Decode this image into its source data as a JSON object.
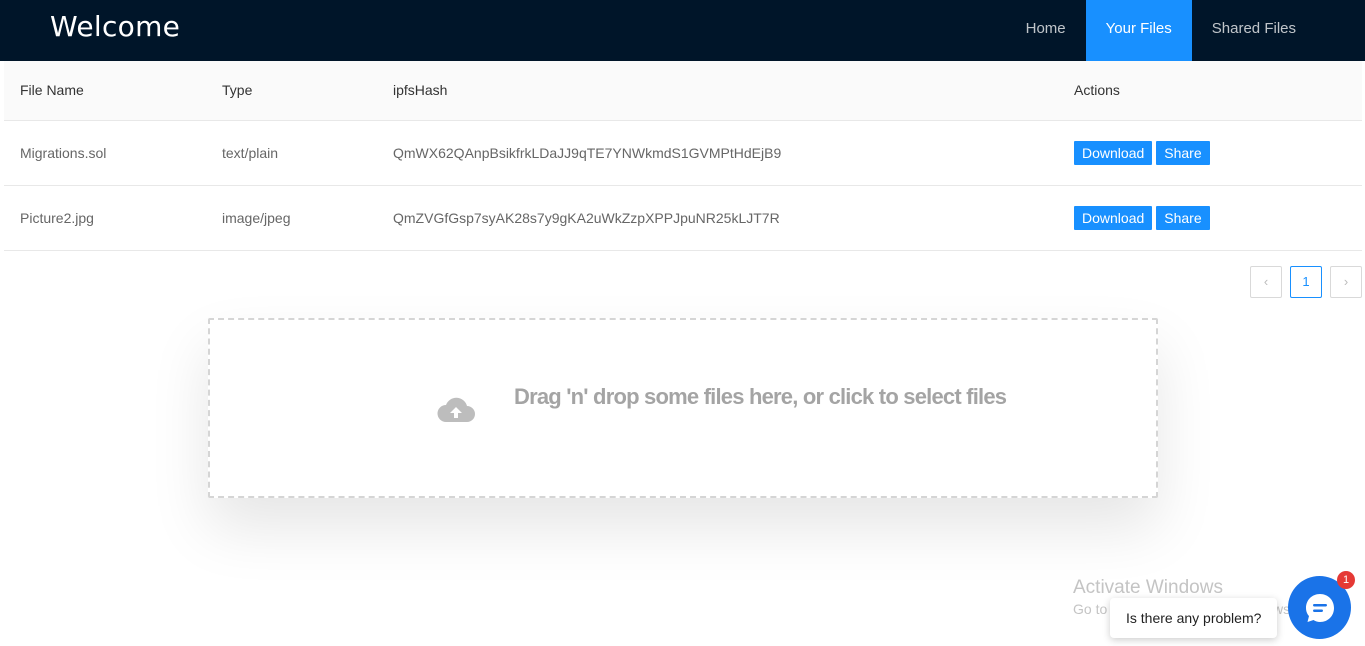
{
  "nav": {
    "brand": "Welcome",
    "items": [
      {
        "label": "Home",
        "active": false
      },
      {
        "label": "Your Files",
        "active": true
      },
      {
        "label": "Shared Files",
        "active": false
      }
    ]
  },
  "table": {
    "headers": [
      "File Name",
      "Type",
      "ipfsHash",
      "Actions"
    ],
    "rows": [
      {
        "name": "Migrations.sol",
        "type": "text/plain",
        "hash": "QmWX62QAnpBsikfrkLDaJJ9qTE7YNWkmdS1GVMPtHdEjB9"
      },
      {
        "name": "Picture2.jpg",
        "type": "image/jpeg",
        "hash": "QmZVGfGsp7syAK28s7y9gKA2uWkZzpXPPJpuNR25kLJT7R"
      }
    ],
    "download_label": "Download",
    "share_label": "Share"
  },
  "pagination": {
    "prev": "‹",
    "current": "1",
    "next": "›"
  },
  "dropzone": {
    "text": "Drag 'n' drop some files here, or click to select files",
    "icon": "cloud-upload-icon"
  },
  "watermark": {
    "line1": "Activate Windows",
    "line2": "Go to Settings to activate Windows."
  },
  "chat": {
    "prompt": "Is there any problem?",
    "badge": "1",
    "icon": "chat-icon"
  },
  "colors": {
    "nav_bg": "#001529",
    "accent": "#1890ff",
    "chat": "#1a73e8",
    "badge": "#e53935"
  }
}
